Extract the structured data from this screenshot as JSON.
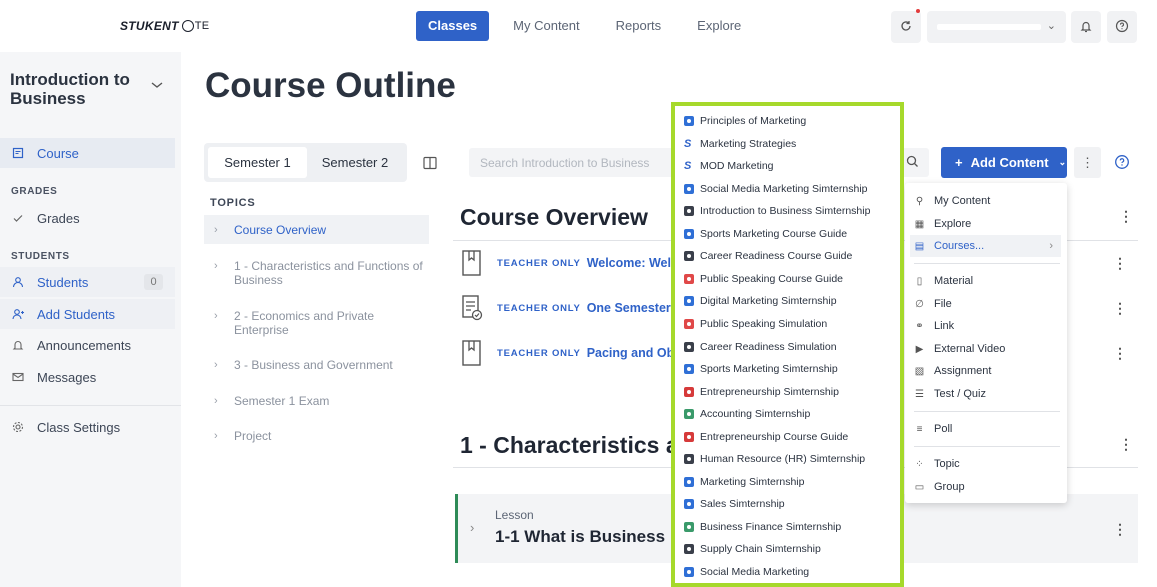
{
  "header": {
    "logo": {
      "brand": "STUKENT",
      "suffix": "TE"
    },
    "nav": [
      "Classes",
      "My Content",
      "Reports",
      "Explore"
    ],
    "active_nav": "Classes"
  },
  "sidebar": {
    "course_title": "Introduction to Business",
    "course": "Course",
    "grades_section": "GRADES",
    "grades": "Grades",
    "students_section": "STUDENTS",
    "students": "Students",
    "students_count": "0",
    "add_students": "Add Students",
    "announcements": "Announcements",
    "messages": "Messages",
    "class_settings": "Class Settings"
  },
  "main": {
    "page_title": "Course Outline",
    "semester_tabs": [
      "Semester 1",
      "Semester 2"
    ],
    "topics_label": "TOPICS",
    "topics": [
      "Course Overview",
      "1 - Characteristics and Functions of Business",
      "2 - Economics and Private Enterprise",
      "3 - Business and Government",
      "Semester 1 Exam",
      "Project"
    ],
    "search_placeholder": "Search Introduction to Business",
    "add_content": "Add Content",
    "sections": {
      "overview": "Course Overview",
      "ch1": "1 - Characteristics a"
    },
    "items": [
      {
        "badge": "TEACHER ONLY",
        "title": "Welcome: Welco"
      },
      {
        "badge": "TEACHER ONLY",
        "title": "One Semester P"
      },
      {
        "badge": "TEACHER ONLY",
        "title": "Pacing and Obje"
      }
    ],
    "lesson": {
      "label": "Lesson",
      "title": "1-1 What is Business"
    }
  },
  "add_menu": {
    "items": [
      "My Content",
      "Explore",
      "Courses...",
      "Material",
      "File",
      "Link",
      "External Video",
      "Assignment",
      "Test / Quiz",
      "Poll",
      "Topic",
      "Group"
    ]
  },
  "courses_menu": [
    {
      "label": "Principles of Marketing",
      "color": "#2f6fd6",
      "type": "square"
    },
    {
      "label": "Marketing Strategies",
      "color": "#2f62c8",
      "type": "s"
    },
    {
      "label": "MOD Marketing",
      "color": "#2f62c8",
      "type": "s"
    },
    {
      "label": "Social Media Marketing Simternship",
      "color": "#2f6fd6",
      "type": "square"
    },
    {
      "label": "Introduction to Business Simternship",
      "color": "#3a3f4a",
      "type": "square"
    },
    {
      "label": "Sports Marketing Course Guide",
      "color": "#2f6fd6",
      "type": "square"
    },
    {
      "label": "Career Readiness Course Guide",
      "color": "#3a3f4a",
      "type": "square"
    },
    {
      "label": "Public Speaking Course Guide",
      "color": "#e04848",
      "type": "square"
    },
    {
      "label": "Digital Marketing Simternship",
      "color": "#2f6fd6",
      "type": "square"
    },
    {
      "label": "Public Speaking Simulation",
      "color": "#e04848",
      "type": "square"
    },
    {
      "label": "Career Readiness Simulation",
      "color": "#3a3f4a",
      "type": "square"
    },
    {
      "label": "Sports Marketing Simternship",
      "color": "#2f6fd6",
      "type": "square"
    },
    {
      "label": "Entrepreneurship Simternship",
      "color": "#d63a3a",
      "type": "square"
    },
    {
      "label": "Accounting Simternship",
      "color": "#3a9a6a",
      "type": "square"
    },
    {
      "label": "Entrepreneurship Course Guide",
      "color": "#d63a3a",
      "type": "square"
    },
    {
      "label": "Human Resource (HR) Simternship",
      "color": "#3a3f4a",
      "type": "square"
    },
    {
      "label": "Marketing Simternship",
      "color": "#2f6fd6",
      "type": "square"
    },
    {
      "label": "Sales Simternship",
      "color": "#2f6fd6",
      "type": "square"
    },
    {
      "label": "Business Finance Simternship",
      "color": "#3a9a6a",
      "type": "square"
    },
    {
      "label": "Supply Chain Simternship",
      "color": "#3a3f4a",
      "type": "square"
    },
    {
      "label": "Social Media Marketing",
      "color": "#2f6fd6",
      "type": "square"
    }
  ],
  "colors": {
    "primary": "#2f62c8",
    "highlight_border": "#a6d92b",
    "lesson_accent": "#2e8b57"
  }
}
